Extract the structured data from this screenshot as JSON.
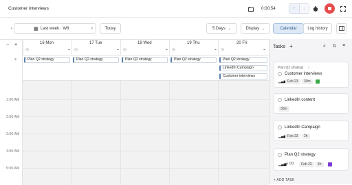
{
  "app_title": "Customer interviews",
  "timer": "0:00:54",
  "toolbar": {
    "date_range": "Last week · W8",
    "today": "Today",
    "view_days": "5 Days",
    "display": "Display",
    "calendar": "Calendar",
    "log_history": "Log history"
  },
  "days": [
    {
      "label": "16 Mon"
    },
    {
      "label": "17 Tue"
    },
    {
      "label": "18 Wed"
    },
    {
      "label": "19 Thu"
    },
    {
      "label": "20 Fri"
    }
  ],
  "allday_events": {
    "mon": "Plan Q2 strategy",
    "tue": "Plan Q2 strategy",
    "wed": "Plan Q2 strategy",
    "thu": "Plan Q2 strategy",
    "fri1": "Plan Q2 strategy",
    "fri2": "LinkedIn Campaign",
    "fri3": "Customer interviews"
  },
  "hours": [
    "1:00 AM",
    "2:00 AM",
    "3:00 AM",
    "4:00 AM",
    "5:00 AM"
  ],
  "tasks_panel": {
    "title": "Tasks",
    "add_task": "+ ADD TASK",
    "cards": [
      {
        "parent": "Plan Q2 strategy",
        "title": "Customer interviews",
        "date": "Feb 23",
        "duration": "30m"
      },
      {
        "title": "LinkedIn content",
        "duration": "30m"
      },
      {
        "title": "LinkedIn Campaign",
        "date": "Feb 23",
        "duration": "2h"
      },
      {
        "title": "Plan Q2 strategy",
        "subtasks": "0/3",
        "date": "Feb 23",
        "duration": "4h"
      }
    ]
  },
  "colors": {
    "accent": "#5b7fa8",
    "record": "#e64b4b",
    "active_tab": "#dde9f6"
  }
}
